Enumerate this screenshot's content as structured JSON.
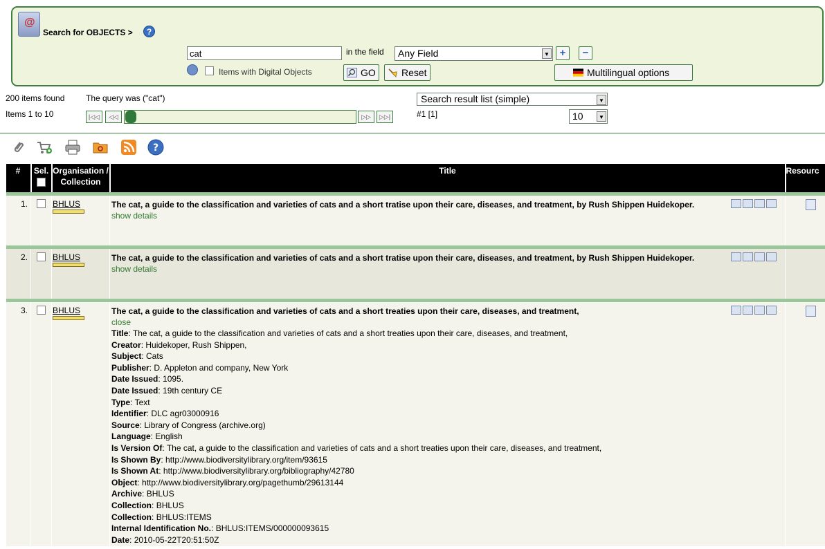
{
  "search": {
    "heading": "Search for OBJECTS >",
    "query_value": "cat",
    "in_field_label": "in the field",
    "field_value": "Any Field",
    "digital_label": "Items with Digital Objects",
    "go_label": "GO",
    "reset_label": "Reset",
    "multilingual_label": "Multilingual options"
  },
  "summary": {
    "items_found": "200 items found",
    "query_was": "The query was (\"cat\")",
    "items_range": "Items 1 to 10",
    "view_value": "Search result list (simple)",
    "page_ref": "#1 [1]",
    "per_page_value": "10"
  },
  "icons": {
    "accent": "#3d7a3d",
    "panel_bg": "#eff4dd",
    "help": "question-icon",
    "add": "+",
    "remove": "−"
  },
  "table": {
    "headers": {
      "num": "#",
      "sel": "Sel.",
      "org": "Organisation / Collection",
      "title": "Title",
      "resource": "Resourc"
    },
    "rows": [
      {
        "num": "1.",
        "org": "BHLUS",
        "title": "The cat, a guide to the classification and varieties of cats and a short tratise upon their care, diseases, and treatment, by Rush Shippen Huidekoper.",
        "toggle": "show details"
      },
      {
        "num": "2.",
        "org": "BHLUS",
        "title": "The cat, a guide to the classification and varieties of cats and a short tratise upon their care, diseases, and treatment, by Rush Shippen Huidekoper.",
        "toggle": "show details"
      },
      {
        "num": "3.",
        "org": "BHLUS",
        "title": "The cat, a guide to the classification and varieties of cats and a short treaties upon their care, diseases, and treatment,",
        "toggle": "close",
        "details": [
          {
            "label": "Title",
            "value": "The cat, a guide to the classification and varieties of cats and a short treaties upon their care, diseases, and treatment,"
          },
          {
            "label": "Creator",
            "value": "Huidekoper, Rush Shippen,"
          },
          {
            "label": "Subject",
            "value": "Cats"
          },
          {
            "label": "Publisher",
            "value": "D. Appleton and company, New York"
          },
          {
            "label": "Date Issued",
            "value": "1095."
          },
          {
            "label": "Date Issued",
            "value": "19th century CE"
          },
          {
            "label": "Type",
            "value": "Text"
          },
          {
            "label": "Identifier",
            "value": "DLC agr03000916"
          },
          {
            "label": "Source",
            "value": "Library of Congress (archive.org)"
          },
          {
            "label": "Language",
            "value": "English"
          },
          {
            "label": "Is Version Of",
            "value": "The cat, a guide to the classification and varieties of cats and a short treaties upon their care, diseases, and treatment,"
          },
          {
            "label": "Is Shown By",
            "value": "http://www.biodiversitylibrary.org/item/93615"
          },
          {
            "label": "Is Shown At",
            "value": "http://www.biodiversitylibrary.org/bibliography/42780"
          },
          {
            "label": "Object",
            "value": "http://www.biodiversitylibrary.org/pagethumb/29613144"
          },
          {
            "label": "Archive",
            "value": "BHLUS"
          },
          {
            "label": "Collection",
            "value": "BHLUS"
          },
          {
            "label": "Collection",
            "value": "BHLUS:ITEMS"
          },
          {
            "label": "Internal Identification No.",
            "value": "BHLUS:ITEMS/000000093615"
          },
          {
            "label": "Date",
            "value": "2010-05-22T20:51:50Z"
          }
        ]
      }
    ]
  }
}
